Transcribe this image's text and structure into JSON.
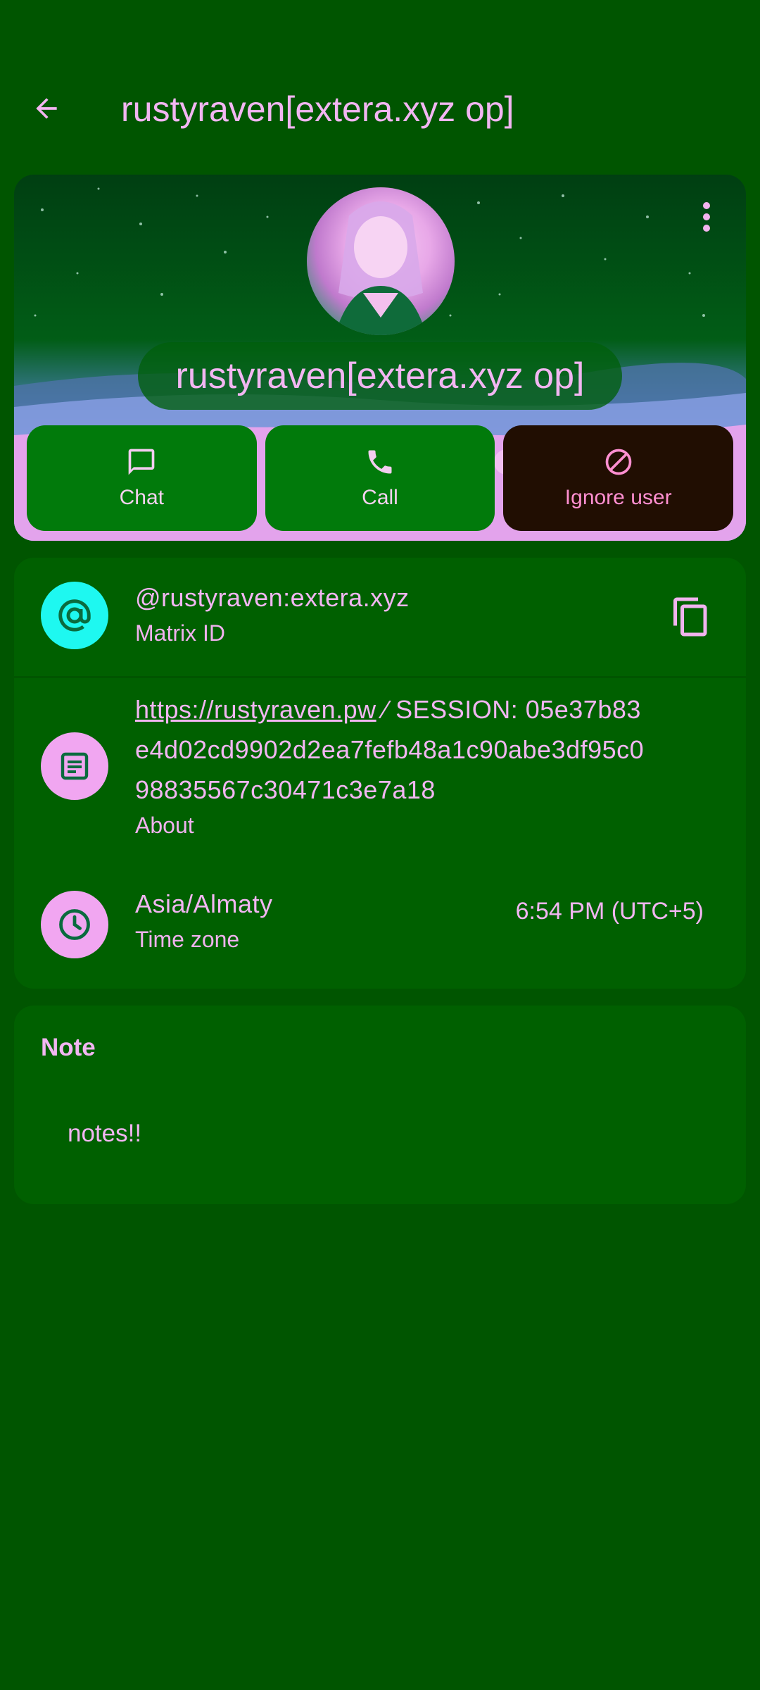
{
  "appbar": {
    "title": "rustyraven[extera.xyz op]",
    "back_icon": "arrow-back-icon"
  },
  "profile": {
    "display_name": "rustyraven[extera.xyz op]",
    "menu_icon": "more-vert-icon",
    "actions": [
      {
        "label": "Chat",
        "icon": "chat-bubble-icon"
      },
      {
        "label": "Call",
        "icon": "phone-icon"
      },
      {
        "label": "Ignore user",
        "icon": "block-icon"
      }
    ]
  },
  "info": {
    "matrix_id": {
      "value": "@rustyraven:extera.xyz",
      "label": "Matrix ID",
      "icon": "at-sign-icon",
      "copy_icon": "copy-icon"
    },
    "about": {
      "link": "https://rustyraven.pw",
      "line1_rest": " ⁄ SESSION: 05e37b83",
      "line2": "e4d02cd9902d2ea7fefb48a1c90abe3df95c0",
      "line3": "98835567c30471c3e7a18",
      "label": "About",
      "icon": "article-icon"
    },
    "timezone": {
      "value": "Asia/Almaty",
      "label": "Time zone",
      "local_time": "6:54 PM (UTC+5)",
      "icon": "clock-icon"
    }
  },
  "note": {
    "title": "Note",
    "body": "notes!!"
  },
  "colors": {
    "background": "#005500",
    "card": "#006000",
    "action_button": "#017a0b",
    "ignore_button": "#210e02",
    "text": "#f2b6f2",
    "matrix_icon_bg": "#1ef8f0",
    "pink_icon_bg": "#f1a6f1"
  }
}
